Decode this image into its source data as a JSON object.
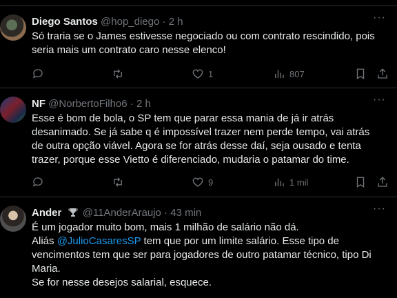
{
  "tweets": [
    {
      "name": "Diego Santos",
      "handle": "@hop_diego",
      "dot": "·",
      "time": "2 h",
      "text": "Só traria se o James estivesse negociado ou com contrato rescindido, pois seria mais um contrato caro nesse elenco!",
      "likes": "1",
      "views": "807"
    },
    {
      "name": "NF",
      "handle": "@NorbertoFilho6",
      "dot": "·",
      "time": "2 h",
      "text": "Esse é bom de bola, o SP tem que parar essa mania de já ir atrás desanimado. Se já sabe q é impossível trazer nem perde tempo, vai atrás de outra opção viável. Agora se for atrás desse daí, seja ousado e tenta trazer, porque esse Vietto é diferenciado, mudaria o patamar do time.",
      "likes": "9",
      "views": "1 mil"
    },
    {
      "name": "Ander",
      "handle": "@11AnderAraujo",
      "dot": "·",
      "time": "43 min",
      "text_line1": "É um jogador muito bom, mais 1 milhão de salário não dá.",
      "text_pre_mention": "Aliás ",
      "mention": "@JulioCasaresSP",
      "text_post_mention": " tem que por um limite salário. Esse tipo de vencimentos tem que ser para jogadores de outro patamar técnico, tipo Di Maria.",
      "text_line_last": "Se for nesse desejos salarial, esquece."
    }
  ],
  "more_label": "···",
  "colors": {
    "background": "#000000",
    "text": "#e7e9ea",
    "secondary": "#71767b",
    "link": "#1d9bf0",
    "divider": "#2f3336"
  }
}
